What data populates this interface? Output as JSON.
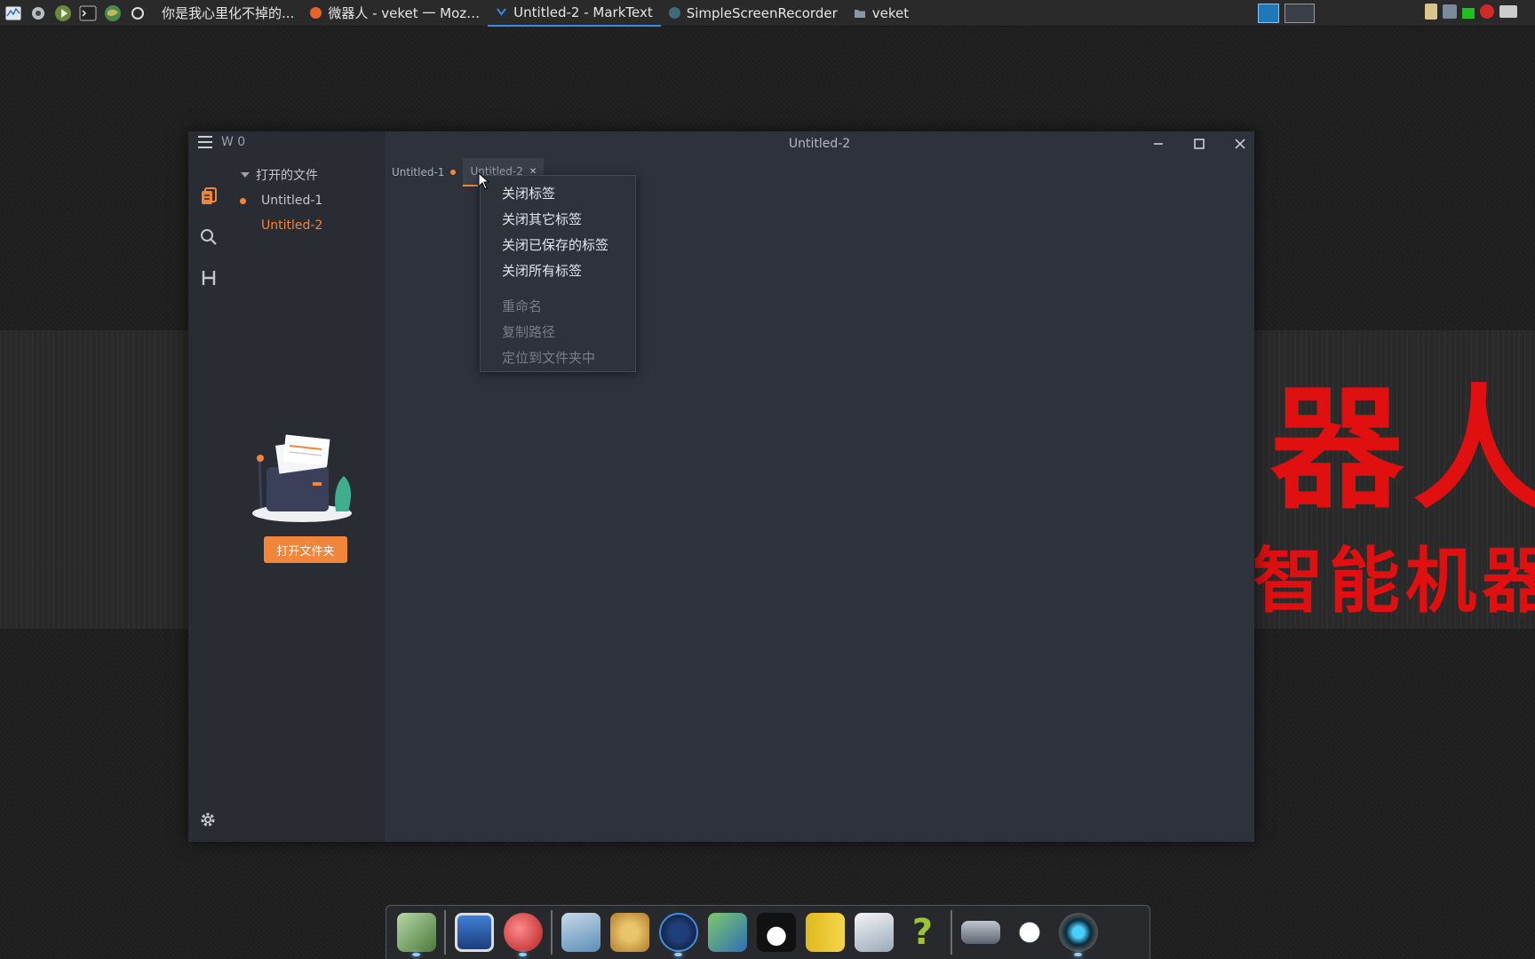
{
  "taskbar": {
    "tasks": [
      {
        "label": "你是我心里化不掉的...",
        "color": "#d4d4d4"
      },
      {
        "label": "微器人 - veket 一 Moz…",
        "color": "#e8622a"
      },
      {
        "label": "Untitled-2 - MarkText",
        "color": "#2f8ef0",
        "active": true
      },
      {
        "label": "SimpleScreenRecorder",
        "color": "#3d6b7a"
      },
      {
        "label": "veket",
        "color": "#9aa0aa"
      }
    ]
  },
  "wallpaper": {
    "big_text": "器人",
    "small_text": "智能机器"
  },
  "window": {
    "title": "Untitled-2",
    "word_count": "W 0",
    "tree_header": "打开的文件",
    "files": [
      "Untitled-1",
      "Untitled-2"
    ],
    "open_folder_label": "打开文件夹",
    "tabs": [
      {
        "label": "Untitled-1"
      },
      {
        "label": "Untitled-2"
      }
    ],
    "context_menu": {
      "items": [
        "关闭标签",
        "关闭其它标签",
        "关闭已保存的标签",
        "关闭所有标签"
      ],
      "disabled_items": [
        "重命名",
        "复制路径",
        "定位到文件夹中"
      ]
    }
  },
  "colors": {
    "accent": "#f1853a",
    "taskbar_active": "#2f8ef0",
    "poster_red": "#e01010"
  }
}
